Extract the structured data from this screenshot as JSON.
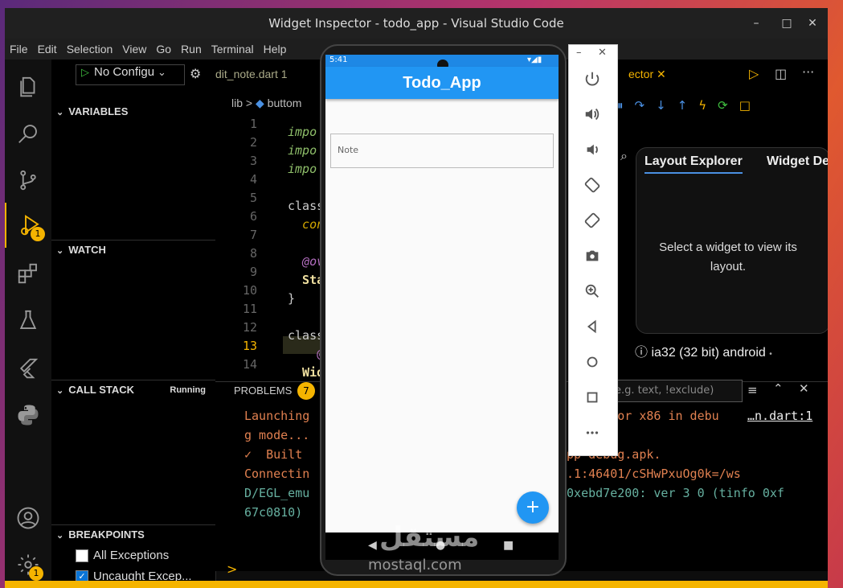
{
  "window": {
    "title": "Widget Inspector - todo_app - Visual Studio Code",
    "controls": {
      "minimize": "–",
      "maximize": "□",
      "close": "✕"
    }
  },
  "menu": [
    "File",
    "Edit",
    "Selection",
    "View",
    "Go",
    "Run",
    "Terminal",
    "Help"
  ],
  "debug_toolbar": {
    "config_label": "No Configu"
  },
  "sidebar": {
    "variables": "VARIABLES",
    "watch": "WATCH",
    "call_stack": "CALL STACK",
    "call_stack_status": "Running",
    "breakpoints": "BREAKPOINTS",
    "bp_items": [
      {
        "label": "All Exceptions",
        "checked": false
      },
      {
        "label": "Uncaught Excep...",
        "checked": true
      }
    ]
  },
  "activity_badges": {
    "run_debug": "1",
    "settings": "1"
  },
  "editor": {
    "tab_label": "dit_note.dart 1",
    "breadcrumb_root": "lib",
    "breadcrumb_file": "buttom",
    "line_numbers": [
      "1",
      "2",
      "3",
      "4",
      "5",
      "6",
      "7",
      "8",
      "9",
      "10",
      "11",
      "12",
      "13",
      "14"
    ],
    "code_lines": [
      {
        "text": "impo",
        "color": "#8fbf6a",
        "italic": true
      },
      {
        "text": "impo",
        "color": "#8fbf6a",
        "italic": true
      },
      {
        "text": "impo",
        "color": "#8fbf6a",
        "italic": true
      },
      {
        "text": "",
        "color": "#ccc"
      },
      {
        "text": "class",
        "color": "#ccc"
      },
      {
        "text": "  con",
        "color": "#d4a800",
        "italic": true
      },
      {
        "text": "",
        "color": "#ccc"
      },
      {
        "text": "  @ov",
        "color": "#b46fc0",
        "italic": true
      },
      {
        "text": "  Sta",
        "color": "#f0e0a0"
      },
      {
        "text": "}",
        "color": "#ccc"
      },
      {
        "text": "",
        "color": "#ccc"
      },
      {
        "text": "class",
        "color": "#ccc"
      },
      {
        "text": "    @",
        "color": "#b46fc0"
      },
      {
        "text": "  Wid",
        "color": "#f0e0a0"
      }
    ],
    "current_line": "13"
  },
  "inspector": {
    "tab_label": "ector",
    "tabs": [
      "Layout Explorer",
      "Widget De"
    ],
    "empty_message": "Select a widget to view its layout.",
    "device": "ia32 (32 bit) android"
  },
  "panel": {
    "problems_label": "PROBLEMS",
    "problems_count": "7",
    "filter_placeholder": "e.g. text, !exclude)",
    "terminal_lines": [
      {
        "text": "Launching",
        "color": "#e08050"
      },
      {
        "text": "g mode...",
        "color": "#e08050"
      },
      {
        "text": "✓  Built",
        "color": "#e08050"
      },
      {
        "text": "Connectin",
        "color": "#e08050"
      },
      {
        "text": "D/EGL_emu",
        "color": "#66b0a0"
      },
      {
        "text": "67c0810)",
        "color": "#66b0a0"
      }
    ],
    "terminal_right": [
      {
        "text": "o       or x86 in debu",
        "color": "#e08050"
      },
      {
        "text": "app-debug.apk.",
        "color": "#e08050"
      },
      {
        "text": "0.1:46401/cSHwPxuOg0k=/ws",
        "color": "#e08050"
      },
      {
        "text": " 0xebd7e200: ver 3 0 (tinfo 0xf",
        "color": "#66b0a0"
      }
    ],
    "link": "…n.dart:1",
    "prompt": ">"
  },
  "phone": {
    "time": "5:41",
    "app_title": "Todo_App",
    "note_label": "Note",
    "fab": "+"
  },
  "watermark": {
    "arabic": "مستقل",
    "latin": "mostaql.com"
  },
  "colors": {
    "accent": "#2196f3",
    "status": "#f5b400"
  }
}
